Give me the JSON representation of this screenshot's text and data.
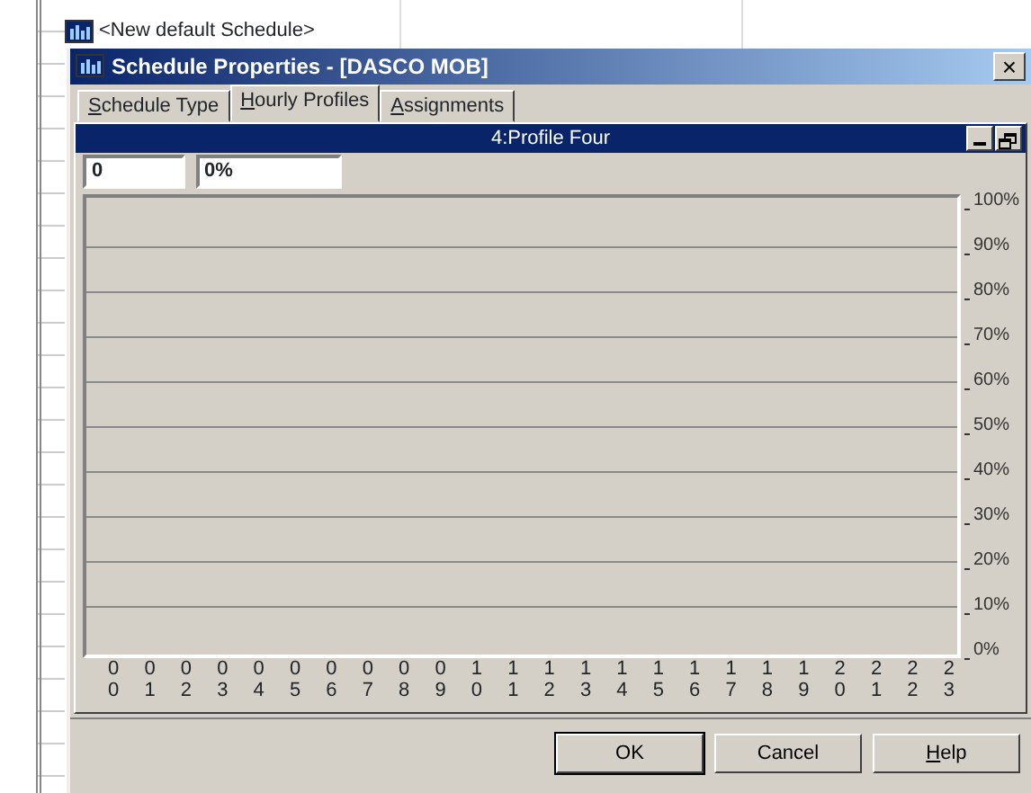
{
  "background_list": {
    "item": "<New default Schedule>"
  },
  "dialog": {
    "title": "Schedule Properties - [DASCO MOB]",
    "close": "×"
  },
  "tabs": [
    {
      "label": "Schedule Type",
      "underline_first": true,
      "selected": false
    },
    {
      "label": "Hourly Profiles",
      "underline_first": true,
      "selected": true
    },
    {
      "label": "Assignments",
      "underline_first": true,
      "selected": false
    }
  ],
  "profile_window": {
    "title": "4:Profile Four"
  },
  "fields": [
    {
      "value": "0"
    },
    {
      "value": "0%"
    }
  ],
  "y_labels": [
    "100%",
    "90%",
    "80%",
    "70%",
    "60%",
    "50%",
    "40%",
    "30%",
    "20%",
    "10%",
    "0%"
  ],
  "hour_labels": [
    "00",
    "01",
    "02",
    "03",
    "04",
    "05",
    "06",
    "07",
    "08",
    "09",
    "10",
    "11",
    "12",
    "13",
    "14",
    "15",
    "16",
    "17",
    "18",
    "19",
    "20",
    "21",
    "22",
    "23"
  ],
  "buttons": [
    {
      "label": "OK",
      "default": true,
      "underline_first": false
    },
    {
      "label": "Cancel",
      "default": false,
      "underline_first": false
    },
    {
      "label": "Help",
      "default": false,
      "underline_first": true
    }
  ]
}
